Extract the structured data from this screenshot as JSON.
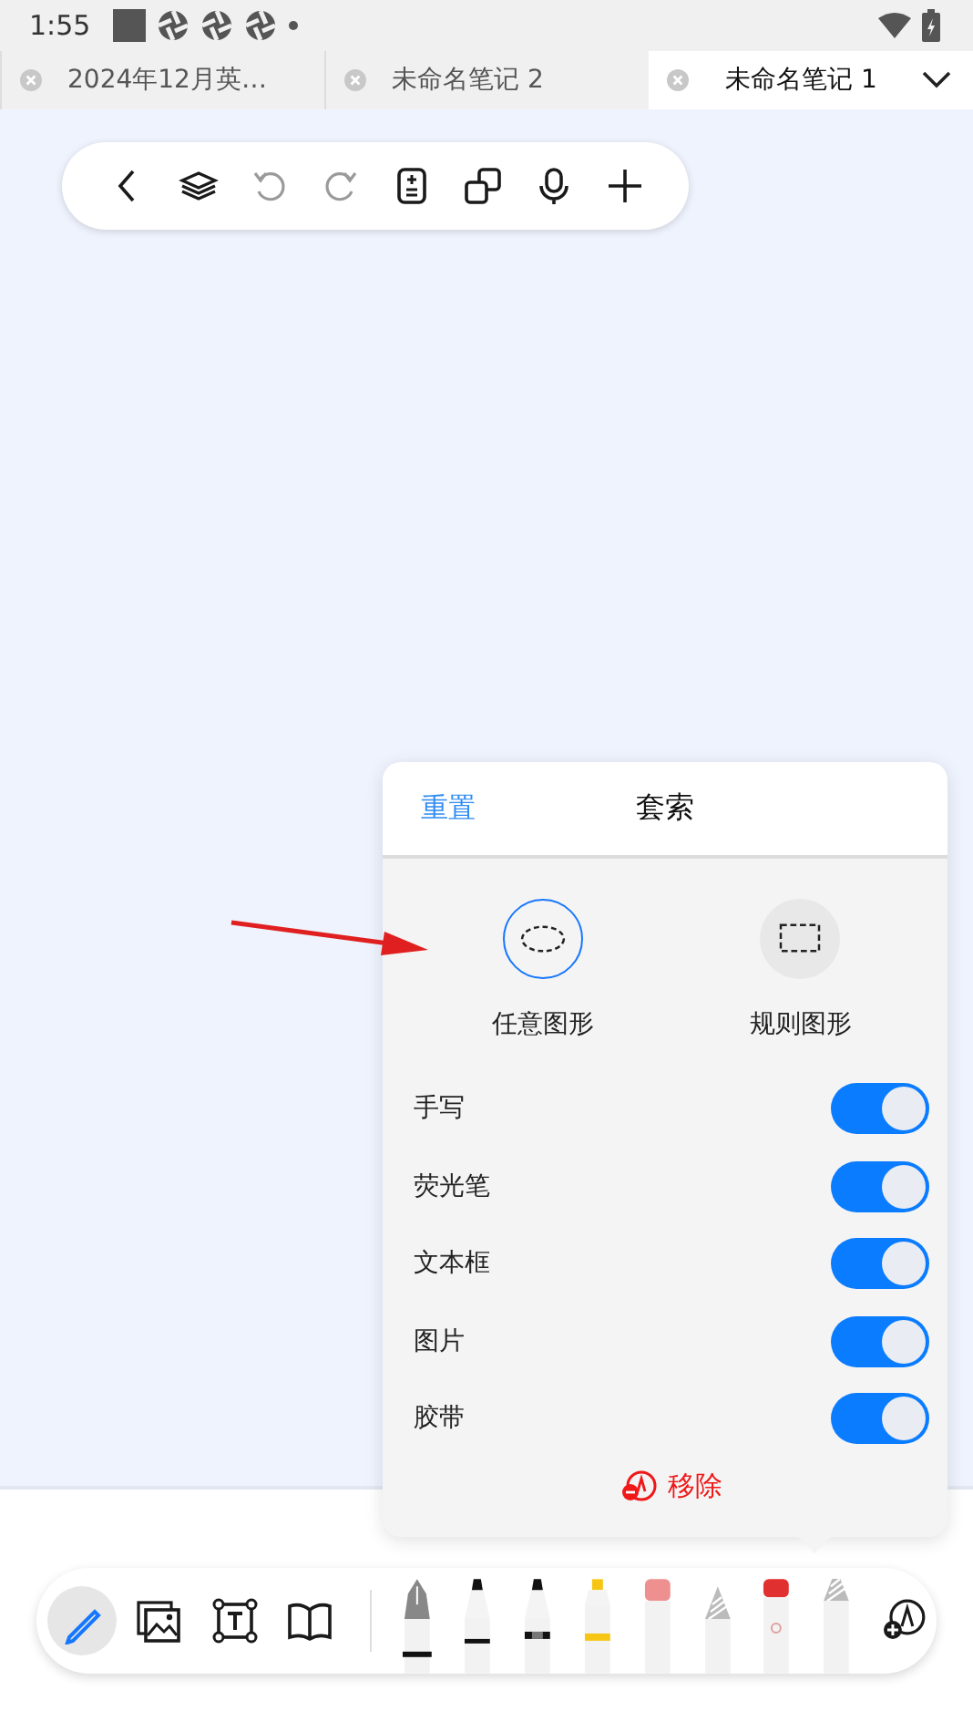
{
  "status_bar": {
    "time": "1:55"
  },
  "tabs": [
    {
      "label": "2024年12月英…",
      "selected": false
    },
    {
      "label": "未命名笔记 2",
      "selected": false
    },
    {
      "label": "未命名笔记 1",
      "selected": true
    }
  ],
  "top_toolbar": [
    {
      "disabled": false
    },
    {
      "disabled": false
    },
    {
      "disabled": true
    },
    {
      "disabled": true
    },
    {
      "disabled": false
    },
    {
      "disabled": false
    },
    {
      "disabled": false
    },
    {
      "disabled": false
    }
  ],
  "lasso_panel": {
    "reset": "重置",
    "title": "套索",
    "shapes": [
      {
        "label": "任意图形",
        "selected": true
      },
      {
        "label": "规则图形",
        "selected": false
      }
    ],
    "filters": [
      {
        "label": "手写",
        "on": true
      },
      {
        "label": "荧光笔",
        "on": true
      },
      {
        "label": "文本框",
        "on": true
      },
      {
        "label": "图片",
        "on": true
      },
      {
        "label": "胶带",
        "on": true
      }
    ],
    "remove": "移除"
  },
  "bottom_tools": [
    {
      "selected": true
    },
    {
      "selected": false
    },
    {
      "selected": false
    },
    {
      "selected": false
    }
  ]
}
